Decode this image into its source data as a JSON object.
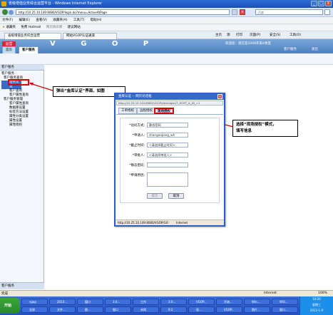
{
  "window": {
    "title": "省级增值业务综合运营平台 - Windows Internet Explorer",
    "min": "_",
    "max": "□",
    "close": "X"
  },
  "address": {
    "url": "http://10.25.10.149:8080/VGOP/login.do?menu=ActiveAtPage",
    "search_placeholder": "百度"
  },
  "menu": [
    "文件(F)",
    "编辑(E)",
    "查看(V)",
    "收藏夹(A)",
    "工具(T)",
    "帮助(H)"
  ],
  "links": [
    "收藏夹",
    "免费 Hotmail",
    "网页快讯库",
    "建议网站"
  ],
  "browser_tabs": [
    "省级增值业务综合运营",
    "网站VGOP认证通道"
  ],
  "commands": [
    "主页",
    "源",
    "打印",
    "页面(P)",
    "安全(S)",
    "工具(O)"
  ],
  "app": {
    "logo": "运营",
    "title_letters": "V G O P",
    "user_info": "欢迎您：现在是2008年第4季度",
    "tabs": [
      "首页",
      "客户服务"
    ],
    "right_links": [
      "客户服务",
      "退出"
    ]
  },
  "sidebar": {
    "header": "客户服务",
    "tree": [
      "客户服务",
      "客户服务查询",
      "话务认证",
      "客户查询",
      "客户属性查询",
      "客户服务管理",
      "客户属性查询",
      "数据库设置",
      "标签方法设置",
      "属性分类设置",
      "属性设置",
      "属性授权"
    ],
    "footer": "客户服务"
  },
  "callout_left": "弹出“金库认证”界面，如图",
  "callout_right": {
    "line1": "选择“现场授权”模式，",
    "line2": "填写信息"
  },
  "dialog": {
    "title": "金库认证 -- 网页对话框",
    "address": "http://10.25.10.149:8080/VGOP/developer/?_HOST_&_ID_=1",
    "tabs": [
      "工单授权",
      "远程授权",
      "现场授权"
    ],
    "fields": [
      {
        "label": "*访问方式:",
        "value": "静态密码"
      },
      {
        "label": "*申请人:",
        "value": "zhangxiqiong_wh"
      },
      {
        "label": "*截止时间:",
        "value": "<请选择截止时间>"
      },
      {
        "label": "*审批人:",
        "value": "<请选择审批人>"
      },
      {
        "label": "*静态密码:",
        "value": ""
      },
      {
        "label": "*申请原因:",
        "value": ""
      }
    ],
    "submit": "提交",
    "cancel": "取消",
    "status_url": "http://10.25.10.149:8080/VGOP/GO",
    "status_zone": "Internet"
  },
  "statusbar": {
    "left": "完成",
    "zone": "Internet",
    "zoom": "100%"
  },
  "taskbar": {
    "start": "开始",
    "buttons": [
      "vgop",
      "2013...",
      "窗口",
      "3.0...",
      "工作",
      "3.0...",
      "VGOP...",
      "开始...",
      "Win...",
      "WSI...",
      "全部",
      "文件...",
      "图...",
      "窗口",
      "未知",
      "9.2",
      "现...",
      "VGOP...",
      "图片...",
      "窗口..."
    ],
    "time": "10:20",
    "day": "星期三",
    "date": "2013-1-9"
  }
}
